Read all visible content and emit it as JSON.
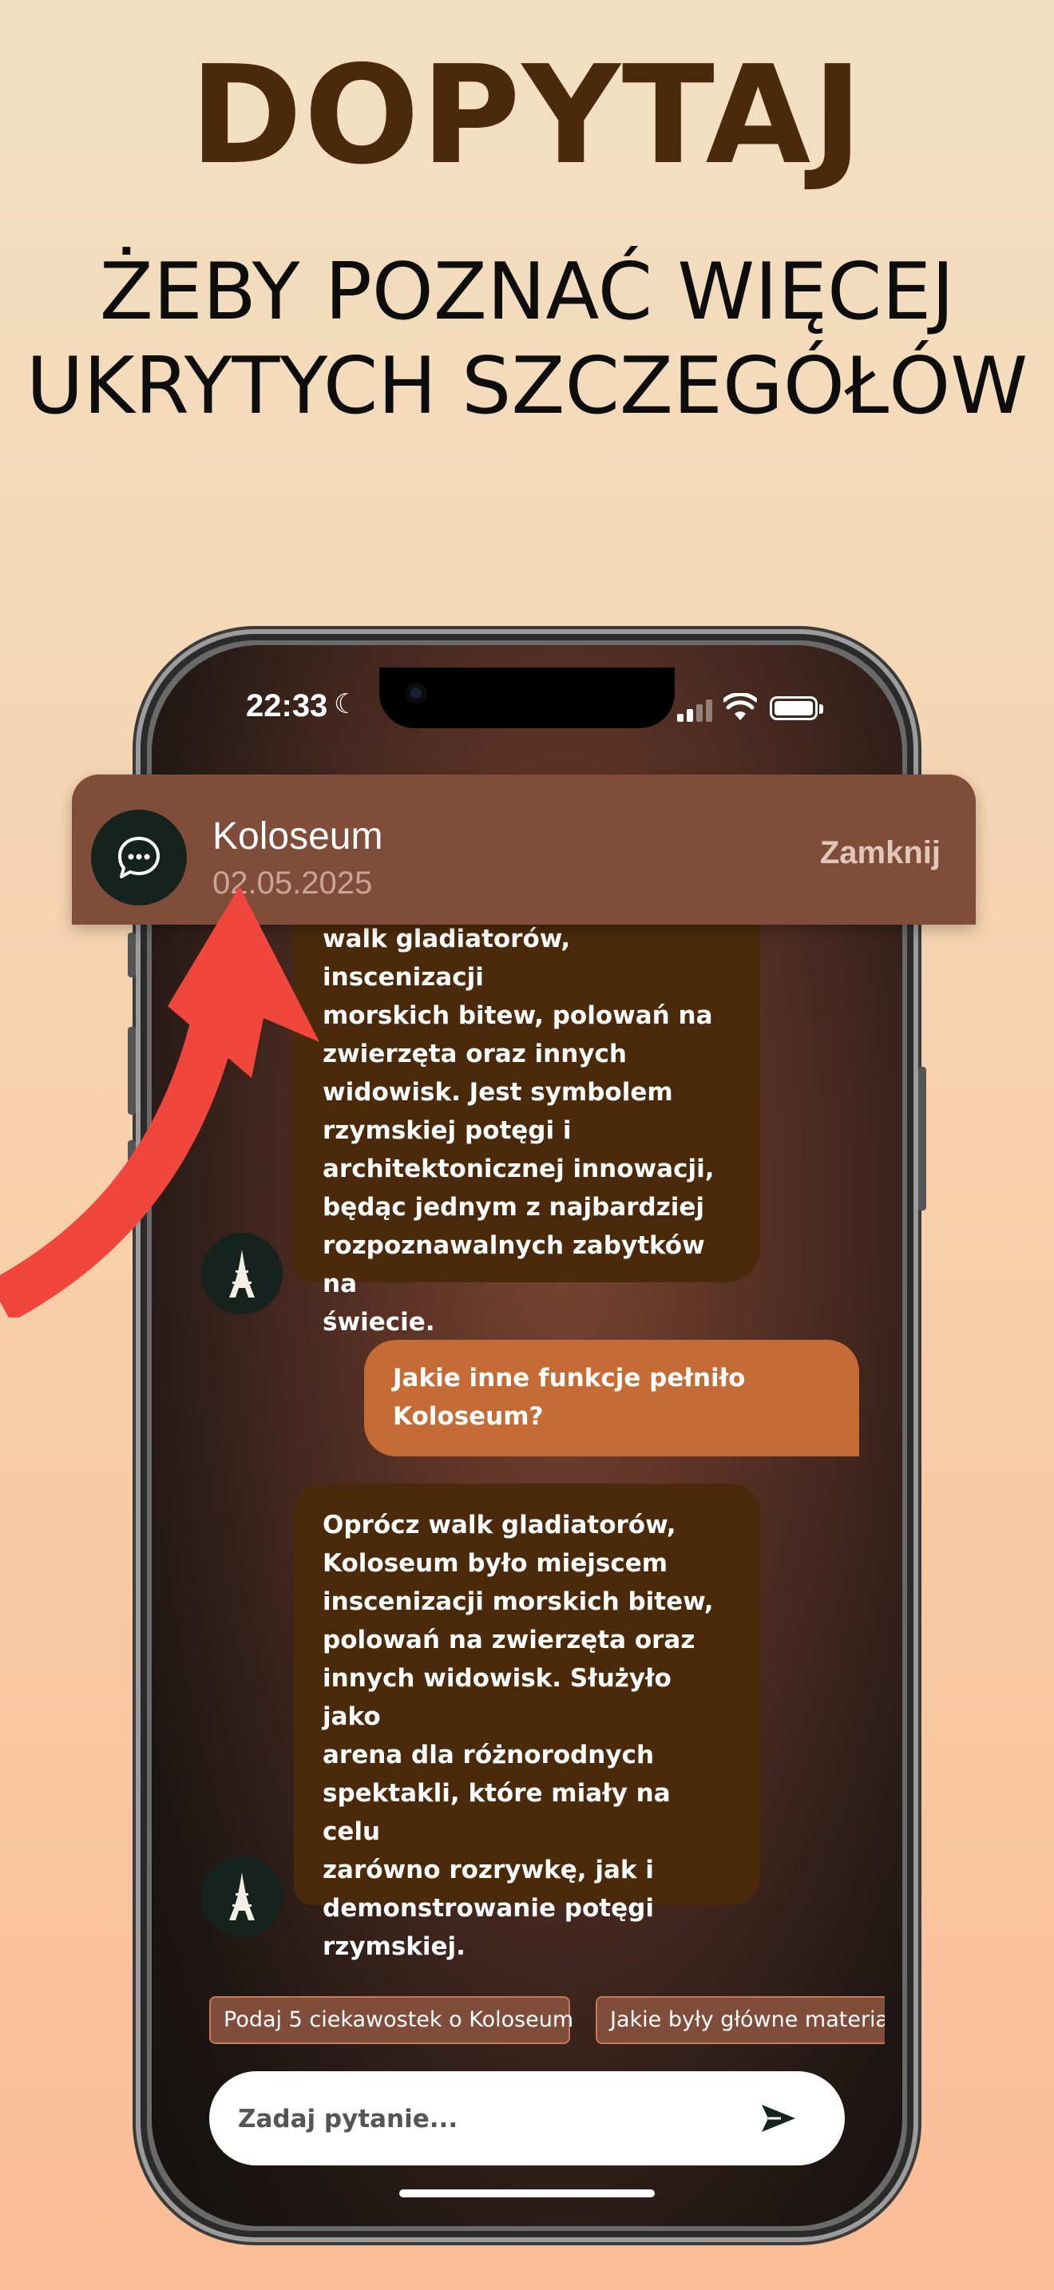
{
  "promo": {
    "headline": "DOPYTAJ",
    "subline_1": "ŻEBY POZNAĆ WIĘCEJ",
    "subline_2": "UKRYTYCH SZCZEGÓŁÓW"
  },
  "status_bar": {
    "time": "22:33"
  },
  "chat_header": {
    "title": "Koloseum",
    "date": "02.05.2025",
    "close_label": "Zamknij",
    "avatar_icon": "chat-bubble-icon"
  },
  "messages": [
    {
      "role": "assistant",
      "lines": [
        "walk gladiatorów, inscenizacji",
        "morskich bitew, polowań na",
        "zwierzęta oraz innych",
        "widowisk. Jest symbolem",
        "rzymskiej potęgi i",
        "architektonicznej innowacji,",
        "będąc jednym z najbardziej",
        "rozpoznawalnych zabytków na",
        "świecie."
      ],
      "avatar_icon": "eiffel-tower-icon"
    },
    {
      "role": "user",
      "lines": [
        "Jakie inne funkcje pełniło",
        "Koloseum?"
      ]
    },
    {
      "role": "assistant",
      "lines": [
        "Oprócz walk gladiatorów,",
        "Koloseum było miejscem",
        "inscenizacji morskich bitew,",
        "polowań na zwierzęta oraz",
        "innych widowisk. Służyło jako",
        "arena dla różnorodnych",
        "spektakli, które miały na celu",
        "zarówno rozrywkę, jak i",
        "demonstrowanie potęgi",
        "rzymskiej."
      ],
      "avatar_icon": "eiffel-tower-icon"
    }
  ],
  "suggestions": [
    "Podaj 5 ciekawostek o Koloseum",
    "Jakie były główne materiały"
  ],
  "input": {
    "placeholder": "Zadaj pytanie...",
    "value": "",
    "send_icon": "send-icon"
  },
  "colors": {
    "headline": "#4a2a0a",
    "bot_bubble": "#4a2a0a",
    "user_bubble": "#c46b36",
    "header_banner": "#804d3b",
    "arrow": "#f0463c"
  }
}
